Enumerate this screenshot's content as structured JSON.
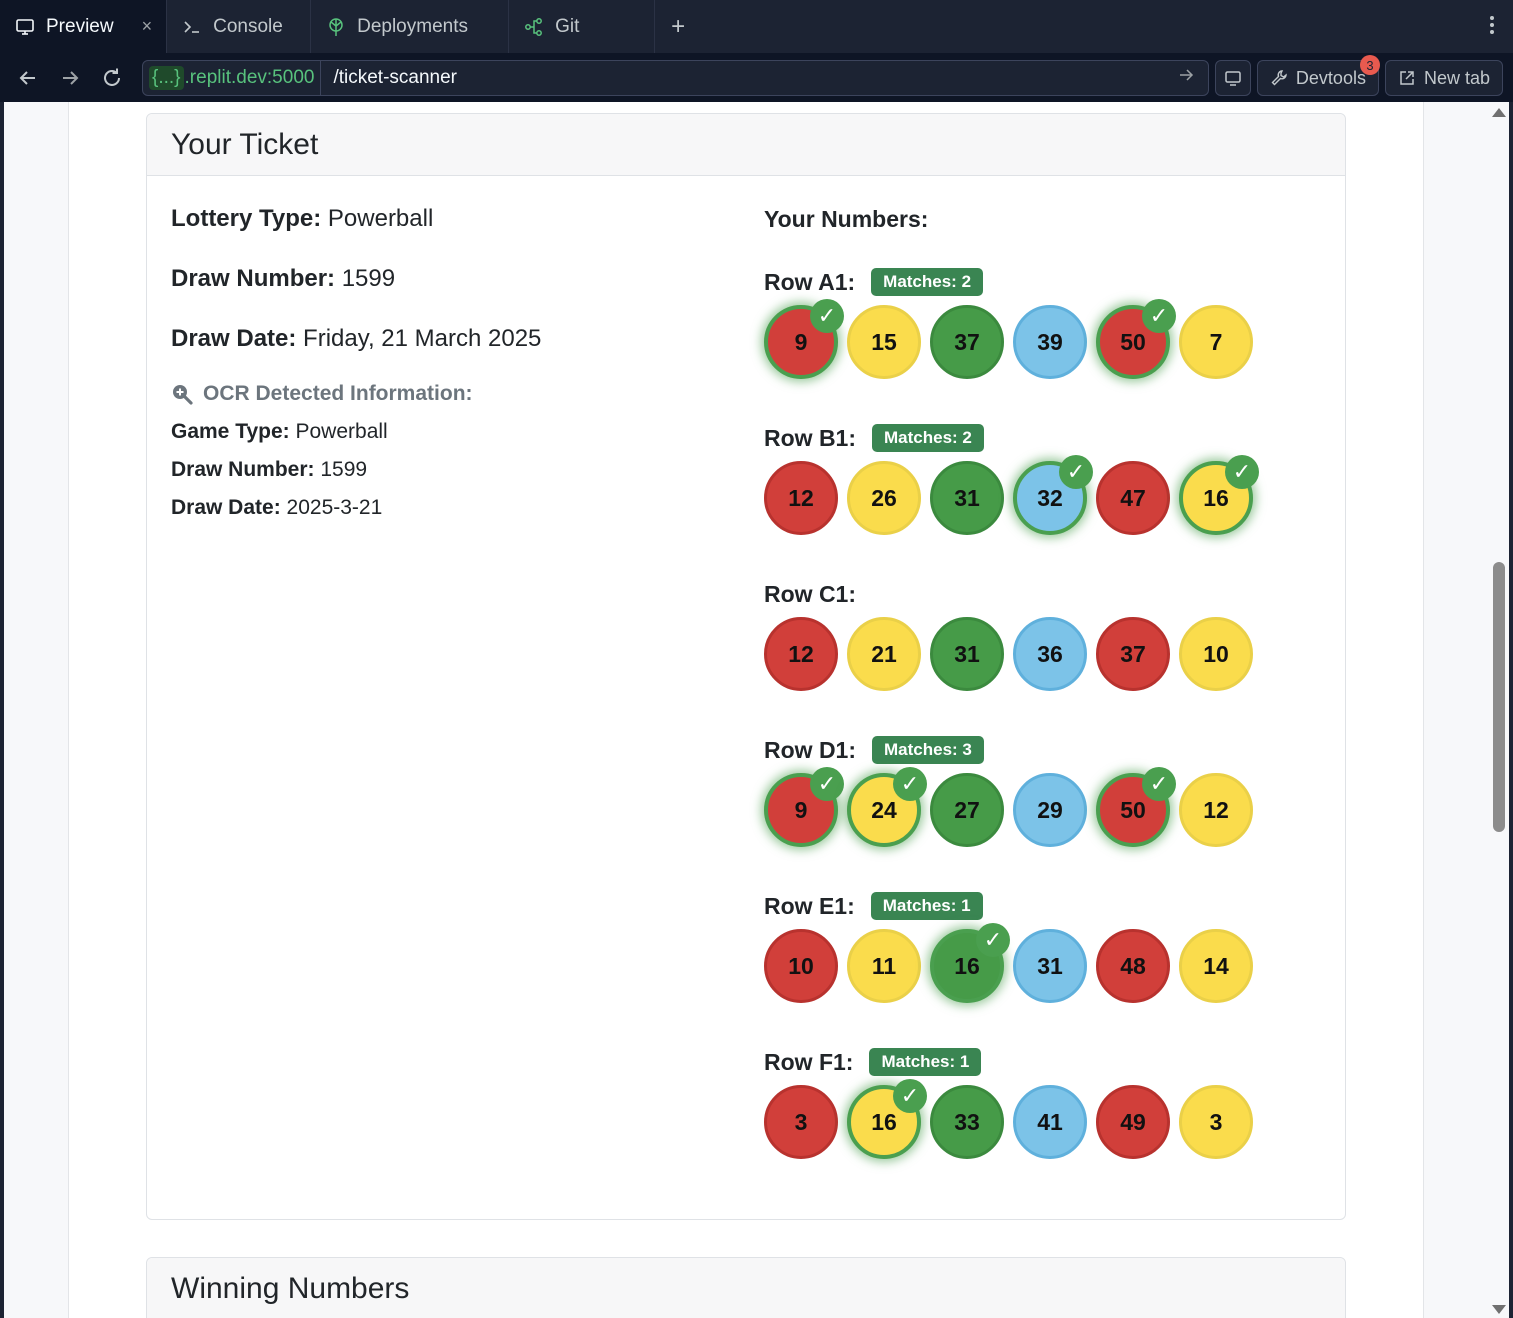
{
  "tabs": [
    {
      "label": "Preview",
      "icon": "monitor-icon",
      "active": true
    },
    {
      "label": "Console",
      "icon": "terminal-icon",
      "active": false
    },
    {
      "label": "Deployments",
      "icon": "deployments-icon",
      "active": false
    },
    {
      "label": "Git",
      "icon": "git-icon",
      "active": false
    }
  ],
  "tab_close": "×",
  "tab_add": "+",
  "address": {
    "host_pill": "{...}",
    "host": ".replit.dev:5000",
    "path": "/ticket-scanner"
  },
  "tools": {
    "devtools_label": "Devtools",
    "devtools_badge": "3",
    "newtab_label": "New tab"
  },
  "ticket": {
    "title": "Your Ticket",
    "lottery_type_label": "Lottery Type:",
    "lottery_type": "Powerball",
    "draw_number_label": "Draw Number:",
    "draw_number": "1599",
    "draw_date_label": "Draw Date:",
    "draw_date": "Friday, 21 March 2025",
    "ocr": {
      "title": "OCR Detected Information:",
      "game_type_label": "Game Type:",
      "game_type": "Powerball",
      "draw_number_label": "Draw Number:",
      "draw_number": "1599",
      "draw_date_label": "Draw Date:",
      "draw_date": "2025-3-21"
    },
    "your_numbers_label": "Your Numbers:",
    "rows": [
      {
        "label": "Row A1:",
        "matches": "Matches: 2",
        "balls": [
          {
            "n": "9",
            "color": "red",
            "match": true
          },
          {
            "n": "15",
            "color": "yellow",
            "match": false
          },
          {
            "n": "37",
            "color": "green",
            "match": false
          },
          {
            "n": "39",
            "color": "blue",
            "match": false
          },
          {
            "n": "50",
            "color": "red",
            "match": true
          },
          {
            "n": "7",
            "color": "yellow",
            "match": false
          }
        ]
      },
      {
        "label": "Row B1:",
        "matches": "Matches: 2",
        "balls": [
          {
            "n": "12",
            "color": "red",
            "match": false
          },
          {
            "n": "26",
            "color": "yellow",
            "match": false
          },
          {
            "n": "31",
            "color": "green",
            "match": false
          },
          {
            "n": "32",
            "color": "blue",
            "match": true
          },
          {
            "n": "47",
            "color": "red",
            "match": false
          },
          {
            "n": "16",
            "color": "yellow",
            "match": true
          }
        ]
      },
      {
        "label": "Row C1:",
        "matches": "",
        "balls": [
          {
            "n": "12",
            "color": "red",
            "match": false
          },
          {
            "n": "21",
            "color": "yellow",
            "match": false
          },
          {
            "n": "31",
            "color": "green",
            "match": false
          },
          {
            "n": "36",
            "color": "blue",
            "match": false
          },
          {
            "n": "37",
            "color": "red",
            "match": false
          },
          {
            "n": "10",
            "color": "yellow",
            "match": false
          }
        ]
      },
      {
        "label": "Row D1:",
        "matches": "Matches: 3",
        "balls": [
          {
            "n": "9",
            "color": "red",
            "match": true
          },
          {
            "n": "24",
            "color": "yellow",
            "match": true
          },
          {
            "n": "27",
            "color": "green",
            "match": false
          },
          {
            "n": "29",
            "color": "blue",
            "match": false
          },
          {
            "n": "50",
            "color": "red",
            "match": true
          },
          {
            "n": "12",
            "color": "yellow",
            "match": false
          }
        ]
      },
      {
        "label": "Row E1:",
        "matches": "Matches: 1",
        "balls": [
          {
            "n": "10",
            "color": "red",
            "match": false
          },
          {
            "n": "11",
            "color": "yellow",
            "match": false
          },
          {
            "n": "16",
            "color": "green",
            "match": true
          },
          {
            "n": "31",
            "color": "blue",
            "match": false
          },
          {
            "n": "48",
            "color": "red",
            "match": false
          },
          {
            "n": "14",
            "color": "yellow",
            "match": false
          }
        ]
      },
      {
        "label": "Row F1:",
        "matches": "Matches: 1",
        "balls": [
          {
            "n": "3",
            "color": "red",
            "match": false
          },
          {
            "n": "16",
            "color": "yellow",
            "match": true
          },
          {
            "n": "33",
            "color": "green",
            "match": false
          },
          {
            "n": "41",
            "color": "blue",
            "match": false
          },
          {
            "n": "49",
            "color": "red",
            "match": false
          },
          {
            "n": "3",
            "color": "yellow",
            "match": false
          }
        ]
      }
    ],
    "check_glyph": "✓"
  },
  "winning": {
    "title": "Winning Numbers"
  },
  "colors": {
    "match_badge": "#3a8552",
    "ball_red": "#d13f3a",
    "ball_yellow": "#fadc4c",
    "ball_green": "#469b48",
    "ball_blue": "#7cc3e8"
  }
}
